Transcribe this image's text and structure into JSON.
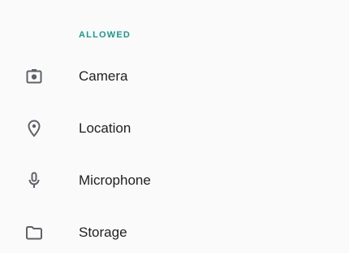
{
  "section": {
    "header": "ALLOWED"
  },
  "permissions": [
    {
      "label": "Camera",
      "icon": "camera-icon"
    },
    {
      "label": "Location",
      "icon": "location-pin-icon"
    },
    {
      "label": "Microphone",
      "icon": "microphone-icon"
    },
    {
      "label": "Storage",
      "icon": "folder-icon"
    }
  ],
  "colors": {
    "accent": "#1a9a8a",
    "icon": "#5f6368",
    "text": "#212121",
    "background": "#fafafa"
  }
}
